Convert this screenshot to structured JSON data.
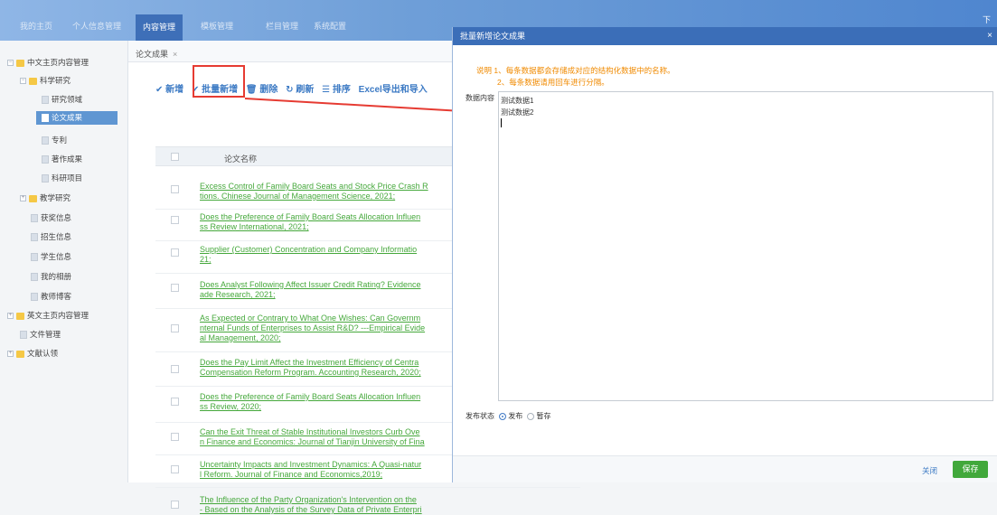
{
  "topnav": {
    "items": [
      "我的主页",
      "个人信息管理",
      "内容管理",
      "模板管理",
      "栏目管理",
      "系统配置"
    ],
    "active": "内容管理",
    "right_text": "下载"
  },
  "sidebar": {
    "items": [
      {
        "label": "中文主页内容管理"
      },
      {
        "label": "科学研究"
      },
      {
        "label": "研究领域"
      },
      {
        "label": "论文成果"
      },
      {
        "label": "专利"
      },
      {
        "label": "著作成果"
      },
      {
        "label": "科研项目"
      },
      {
        "label": "教学研究"
      },
      {
        "label": "获奖信息"
      },
      {
        "label": "招生信息"
      },
      {
        "label": "学生信息"
      },
      {
        "label": "我的相册"
      },
      {
        "label": "教师博客"
      },
      {
        "label": "英文主页内容管理"
      },
      {
        "label": "文件管理"
      },
      {
        "label": "文献认领"
      }
    ]
  },
  "tab": {
    "label": "论文成果",
    "close": "×"
  },
  "toolbar": {
    "add": "✔ 新增",
    "batch_add": "✔ 批量新增",
    "delete": "🗑 删除",
    "refresh": "↻ 刷新",
    "sort": "☰ 排序",
    "excel": "Excel导出和导入"
  },
  "table": {
    "header": "论文名称",
    "rows": [
      {
        "l1": "Excess Control of Family Board Seats and Stock Price Crash R",
        "l2": "tions. Chinese Journal of Management Science, 2021;"
      },
      {
        "l1": "Does the Preference of Family Board Seats Allocation Influen",
        "l2": "ss Review International, 2021;"
      },
      {
        "l1": "Supplier (Customer) Concentration and Company Informatio",
        "l2": "21;"
      },
      {
        "l1": "Does Analyst Following Affect Issuer Credit Rating? Evidence",
        "l2": "ade Research, 2021;"
      },
      {
        "l1": "As Expected or Contrary to What One Wishes:  Can Governm",
        "l2": "nternal Funds of Enterprises to Assist R&D? ---Empirical Evide",
        "l3": "al Management, 2020;"
      },
      {
        "l1": "Does the Pay Limit Affect the Investment Efficiency of Centra",
        "l2": "Compensation Reform Program. Accounting Research, 2020;"
      },
      {
        "l1": "Does the Preference of Family Board Seats Allocation Influen",
        "l2": "ss Review, 2020;"
      },
      {
        "l1": "Can the Exit Threat of Stable Institutional Investors Curb Ove",
        "l2": "n Finance and Economics: Journal of Tianjin University of Fina"
      },
      {
        "l1": "Uncertainty Impacts and Investment Dynamics: A Quasi-natur",
        "l2": "l Reform. Journal of Finance and Economics,2019;"
      },
      {
        "l1": "The Influence of the Party Organization's Intervention on the",
        "l2": "- Based on the Analysis of the Survey Data of Private Enterpri"
      }
    ]
  },
  "dialog": {
    "title": "批量新增论文成果",
    "close": "×",
    "note1": "说明 1、每条数据都会存储成对应的结构化数据中的名称。",
    "note2": "2、每条数据请用回车进行分隔。",
    "content_label": "数据内容",
    "content_line1": "测试数据1",
    "content_line2": "测试数据2",
    "status_label": "发布状态",
    "opt_publish": "发布",
    "opt_draft": "暂存",
    "close_btn": "关闭",
    "save_btn": "保存"
  },
  "colors": {
    "nav_active": "#3e6fb8",
    "sidebar_selected": "#5f96d2",
    "link_green": "#45a83b",
    "annotation_red": "#e63b32",
    "note_orange": "#f08a00",
    "dialog_header": "#3b6eb8",
    "save_green": "#41a83b"
  }
}
